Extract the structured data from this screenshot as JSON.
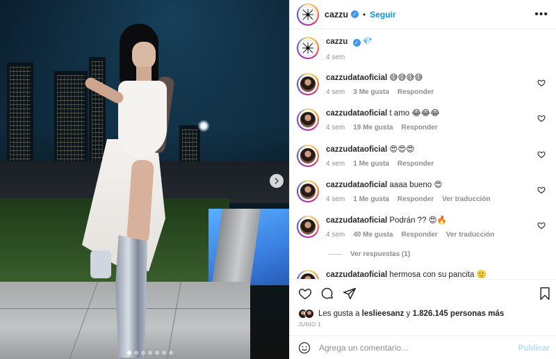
{
  "post": {
    "author": "cazzu",
    "follow_label": "Seguir",
    "separator": "•",
    "caption_emoji": "💎",
    "caption_time": "4 sem",
    "carousel_dots": 7,
    "carousel_active_index": 0
  },
  "comments": [
    {
      "user": "cazzudataoficial",
      "text": "😅😅😅😅",
      "time": "4 sem",
      "likes": "3 Me gusta",
      "reply": "Responder",
      "translate": ""
    },
    {
      "user": "cazzudataoficial",
      "text": "t amo 😂😂😂",
      "time": "4 sem",
      "likes": "19 Me gusta",
      "reply": "Responder",
      "translate": ""
    },
    {
      "user": "cazzudataoficial",
      "text": "😍😍😍",
      "time": "4 sem",
      "likes": "1 Me gusta",
      "reply": "Responder",
      "translate": ""
    },
    {
      "user": "cazzudataoficial",
      "text": "aaaa bueno 😍",
      "time": "4 sem",
      "likes": "1 Me gusta",
      "reply": "Responder",
      "translate": "Ver traducción"
    },
    {
      "user": "cazzudataoficial",
      "text": "Podrán ?? 😍🔥",
      "time": "4 sem",
      "likes": "40 Me gusta",
      "reply": "Responder",
      "translate": "Ver traducción"
    },
    {
      "user": "cazzudataoficial",
      "text": "hermosa con su pancita 🙂",
      "time": "",
      "likes": "",
      "reply": "",
      "translate": ""
    }
  ],
  "view_replies": "Ver respuestas (1)",
  "likes": {
    "prefix": "Les gusta a",
    "user": "leslieesanz",
    "connector": "y",
    "count": "1.826.145 personas más"
  },
  "date": "JUNIO 1",
  "comment_box": {
    "placeholder": "Agrega un comentario...",
    "publish_label": "Publicar"
  },
  "colors": {
    "link_blue": "#0095f6",
    "verified_blue": "#3897f0",
    "muted": "#8e8e8e",
    "publish_disabled": "#b2dffc"
  },
  "icons": [
    "spider-logo-icon",
    "verified-icon",
    "more-options-icon",
    "heart-icon",
    "comment-icon",
    "share-icon",
    "bookmark-icon",
    "emoji-icon",
    "carousel-next-icon"
  ]
}
